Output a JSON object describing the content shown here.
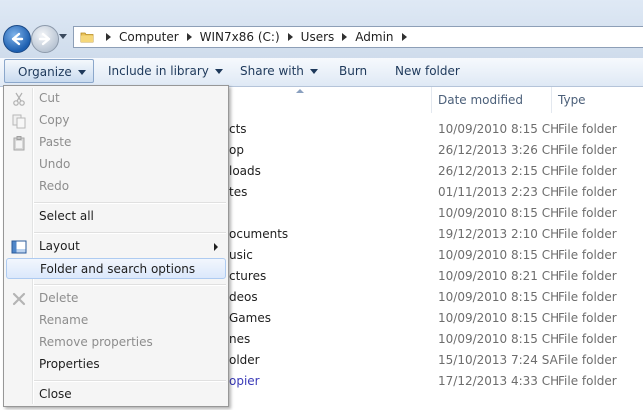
{
  "breadcrumb": [
    "Computer",
    "WIN7x86 (C:)",
    "Users",
    "Admin"
  ],
  "toolbar": {
    "organize": "Organize",
    "include": "Include in library",
    "share": "Share with",
    "burn": "Burn",
    "new_folder": "New folder"
  },
  "columns": {
    "date": "Date modified",
    "type": "Type"
  },
  "rows": [
    {
      "name": "cts",
      "date": "10/09/2010 8:15 CH",
      "type": "File folder"
    },
    {
      "name": "op",
      "date": "26/12/2013 3:26 CH",
      "type": "File folder"
    },
    {
      "name": "loads",
      "date": "26/12/2013 2:15 CH",
      "type": "File folder"
    },
    {
      "name": "tes",
      "date": "01/11/2013 2:23 CH",
      "type": "File folder"
    },
    {
      "name": "",
      "date": "10/09/2010 8:15 CH",
      "type": "File folder"
    },
    {
      "name": "ocuments",
      "date": "19/12/2013 2:10 CH",
      "type": "File folder"
    },
    {
      "name": "usic",
      "date": "10/09/2010 8:15 CH",
      "type": "File folder"
    },
    {
      "name": "ctures",
      "date": "10/09/2010 8:21 CH",
      "type": "File folder"
    },
    {
      "name": "deos",
      "date": "10/09/2010 8:15 CH",
      "type": "File folder"
    },
    {
      "name": "Games",
      "date": "10/09/2010 8:15 CH",
      "type": "File folder"
    },
    {
      "name": "nes",
      "date": "10/09/2010 8:15 CH",
      "type": "File folder"
    },
    {
      "name": "older",
      "date": "15/10/2013 7:24 SA",
      "type": "File folder"
    },
    {
      "name": "opier",
      "date": "17/12/2013 4:33 CH",
      "type": "File folder"
    }
  ],
  "menu": {
    "cut": "Cut",
    "copy": "Copy",
    "paste": "Paste",
    "undo": "Undo",
    "redo": "Redo",
    "select_all": "Select all",
    "layout": "Layout",
    "folder_options": "Folder and search options",
    "delete": "Delete",
    "rename": "Rename",
    "remove_properties": "Remove properties",
    "properties": "Properties",
    "close": "Close"
  }
}
